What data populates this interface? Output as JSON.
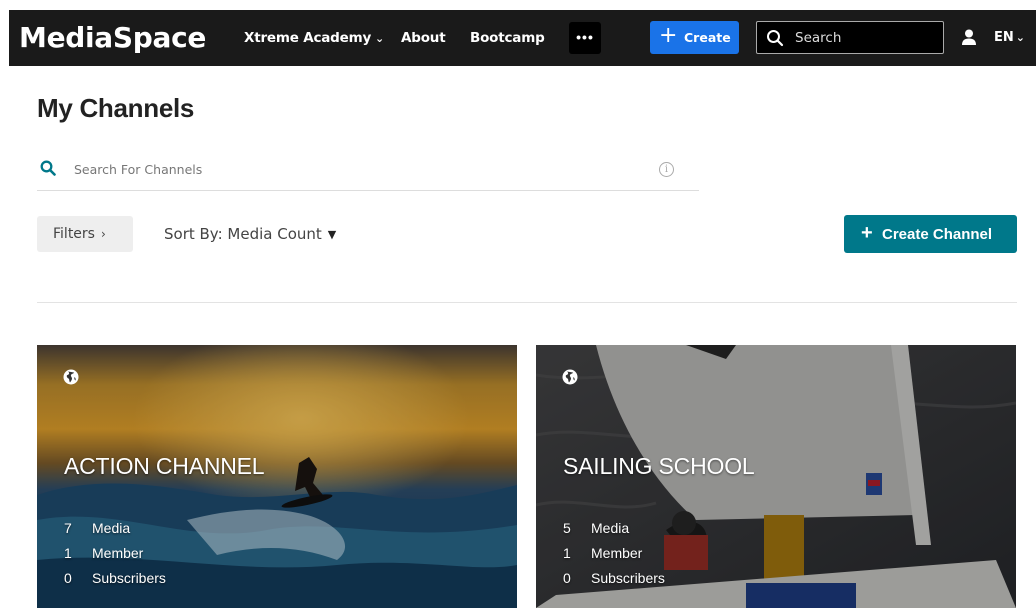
{
  "header": {
    "logo": "MediaSpace",
    "nav": [
      {
        "label": "Xtreme Academy",
        "has_menu": true
      },
      {
        "label": "About"
      },
      {
        "label": "Bootcamp"
      }
    ],
    "more_label": "•••",
    "create_label": "Create",
    "search": {
      "placeholder": "Search"
    },
    "language": "EN",
    "icons": {
      "search": "search-icon",
      "user": "user-icon",
      "more": "more-dots-icon"
    },
    "colors": {
      "bar": "#1a1a1a",
      "create": "#1a73e8"
    }
  },
  "page": {
    "title": "My Channels",
    "search": {
      "placeholder": "Search For Channels"
    },
    "filters_label": "Filters",
    "sort_label": "Sort By: Media Count",
    "create_channel_label": "Create Channel",
    "colors": {
      "accent": "#00788a"
    }
  },
  "channels": [
    {
      "title": "ACTION CHANNEL",
      "icon": "globe-icon",
      "stats": [
        {
          "count": "7",
          "label": "Media"
        },
        {
          "count": "1",
          "label": "Member"
        },
        {
          "count": "0",
          "label": "Subscribers"
        }
      ]
    },
    {
      "title": "SAILING SCHOOL",
      "icon": "globe-icon",
      "stats": [
        {
          "count": "5",
          "label": "Media"
        },
        {
          "count": "1",
          "label": "Member"
        },
        {
          "count": "0",
          "label": "Subscribers"
        }
      ]
    }
  ]
}
